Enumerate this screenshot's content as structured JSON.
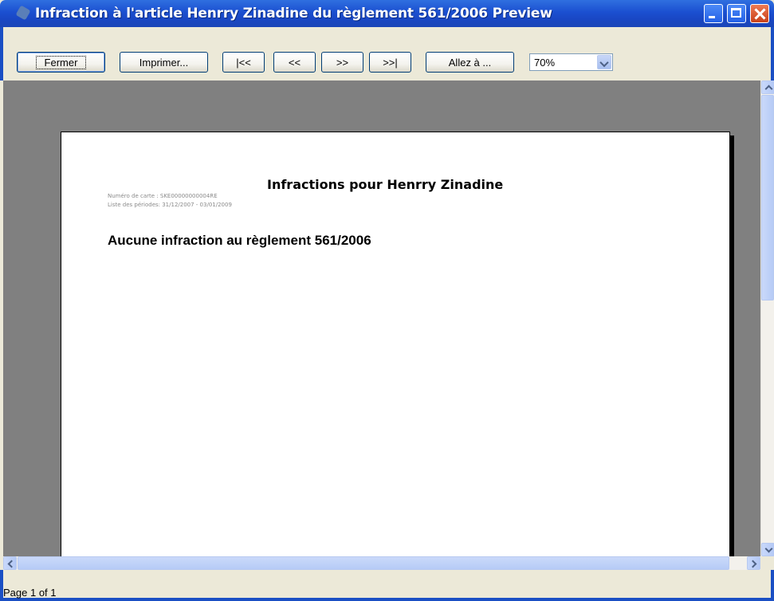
{
  "window": {
    "title": "Infraction à l'article Henrry Zinadine du règlement 561/2006 Preview"
  },
  "toolbar": {
    "close_label": "Fermer",
    "print_label": "Imprimer...",
    "first_label": "|<<",
    "prev_label": "<<",
    "next_label": ">>",
    "last_label": ">>|",
    "goto_label": "Allez à ...",
    "zoom_value": "70%"
  },
  "document": {
    "title": "Infractions pour Henrry Zinadine",
    "card_number": "Numéro de carte : SKE00000000004RE",
    "periods": "Liste des périodes: 31/12/2007 - 03/01/2009",
    "heading": "Aucune infraction au règlement 561/2006"
  },
  "status": {
    "page_text": "Page 1 of 1"
  },
  "icons": {
    "app": "app-icon",
    "minimize": "minimize-icon",
    "maximize": "maximize-icon",
    "close": "close-icon",
    "dropdown": "chevron-down-icon"
  },
  "colors": {
    "titlebar": "#1b4fd0",
    "preview_background": "#808080",
    "page": "#ffffff"
  }
}
